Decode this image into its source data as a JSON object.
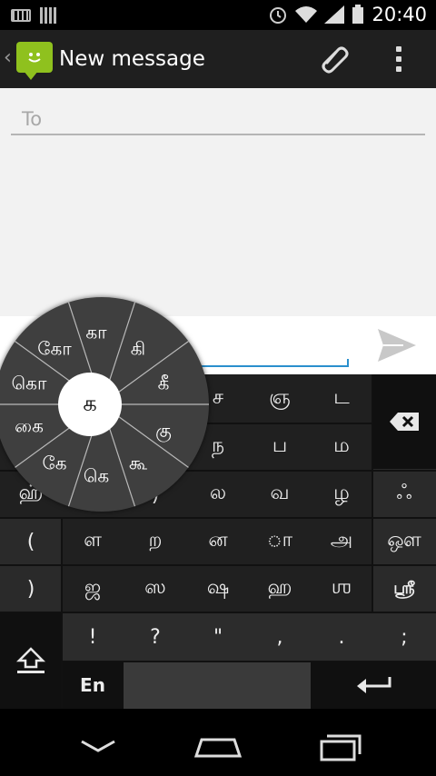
{
  "status_bar": {
    "time": "20:40"
  },
  "action_bar": {
    "back_glyph": "‹",
    "title": "New message",
    "attach_icon": "paperclip-icon",
    "overflow_icon": "overflow-menu-icon"
  },
  "compose": {
    "to_placeholder": "To"
  },
  "keyboard": {
    "rows": [
      [
        "ச",
        "ஞ",
        "ட"
      ],
      [
        "ந",
        "ப",
        "ம"
      ],
      [
        "ல",
        "வ",
        "ழ"
      ],
      [
        "ள",
        "ற",
        "ன",
        "ா",
        "அ"
      ],
      [
        "ஜ",
        "ஸ",
        "ஷ",
        "ஹ",
        "ஶ"
      ]
    ],
    "row3_left": "ஹ்",
    "row3_paren": ")",
    "right_column": [
      "ஃ",
      "ஔ",
      "ஶ்ரீ"
    ],
    "left_column": [
      "(",
      ")"
    ],
    "punctuation": [
      "!",
      "?",
      "\"",
      ",",
      ".",
      ";"
    ],
    "lang": "En",
    "backspace_icon": "backspace-icon",
    "shift_icon": "shift-icon",
    "enter_icon": "enter-icon"
  },
  "wheel": {
    "center": "க",
    "petals": [
      "கா",
      "கி",
      "கீ",
      "கு",
      "கூ",
      "கெ",
      "கே",
      "கை",
      "கொ",
      "கோ"
    ]
  },
  "nav": {
    "back": "back-icon",
    "home": "home-icon",
    "recents": "recents-icon"
  },
  "colors": {
    "accent": "#2a8fcd",
    "app_icon": "#8fc11e"
  }
}
